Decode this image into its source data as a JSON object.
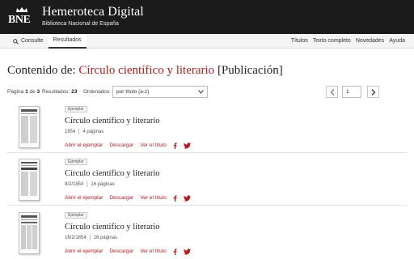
{
  "header": {
    "logo_text": "BNE",
    "title": "Hemeroteca Digital",
    "subtitle": "Biblioteca Nacional de España"
  },
  "nav": {
    "left": [
      {
        "label": "Consulte",
        "icon": "search-icon",
        "active": false
      },
      {
        "label": "Resultados",
        "active": true
      }
    ],
    "right": [
      "Títulos",
      "Texto completo",
      "Novedades",
      "Ayuda"
    ]
  },
  "page": {
    "title_prefix": "Contenido de:",
    "title_name": "Círculo científico y literario",
    "title_suffix": "[Publicación]"
  },
  "toolbar": {
    "page_label": "Página",
    "page_current": "1",
    "page_of": "de",
    "page_total": "3",
    "results_label": "Resultados:",
    "results_count": "23",
    "sort_label": "Ordenados:",
    "sort_value": "por título (a-z)",
    "page_input_value": "1"
  },
  "results": [
    {
      "badge": "Ejemplar",
      "title": "Círculo científico y literario",
      "date": "1854",
      "pages": "4 páginas",
      "actions": [
        "Abrir el ejemplar",
        "Descargar",
        "Ver el título"
      ]
    },
    {
      "badge": "Ejemplar",
      "title": "Círculo científico y literario",
      "date": "8/2/1854",
      "pages": "16 páginas",
      "actions": [
        "Abrir el ejemplar",
        "Descargar",
        "Ver el título"
      ]
    },
    {
      "badge": "Ejemplar",
      "title": "Círculo científico y literario",
      "date": "16/2/1854",
      "pages": "16 páginas",
      "actions": [
        "Abrir el ejemplar",
        "Descargar",
        "Ver el título"
      ]
    }
  ],
  "share_icons": [
    "facebook-icon",
    "twitter-icon"
  ],
  "colors": {
    "header_bg": "#1b1b1b",
    "accent_red": "#b51b1b",
    "nav_bg": "#f4f4f4"
  }
}
